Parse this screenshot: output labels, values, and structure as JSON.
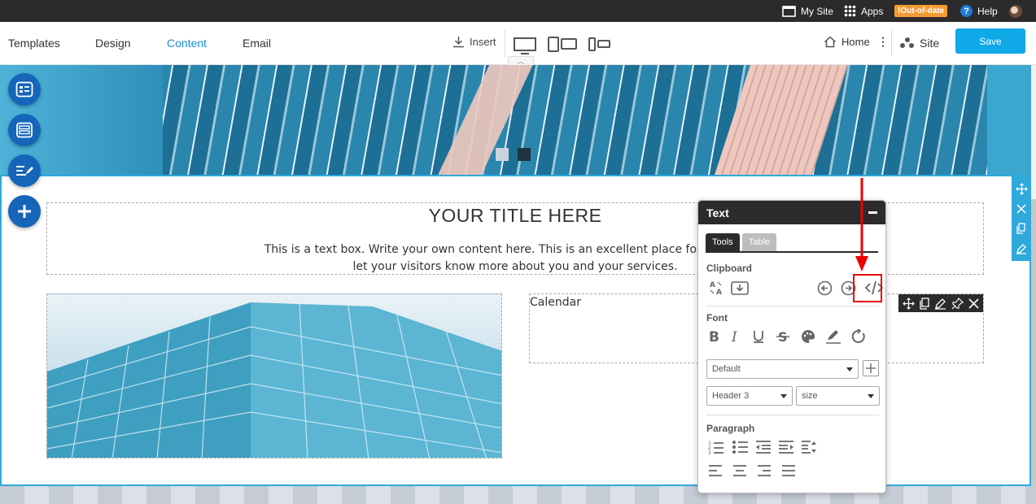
{
  "topbar": {
    "my_site": "My Site",
    "apps": "Apps",
    "badge": "!Out-of-date",
    "help": "Help"
  },
  "nav": {
    "tabs": [
      {
        "label": "Templates"
      },
      {
        "label": "Design"
      },
      {
        "label": "Content",
        "active": true
      },
      {
        "label": "Email"
      }
    ],
    "insert": "Insert",
    "home": "Home",
    "site": "Site",
    "save": "Save"
  },
  "content": {
    "title": "YOUR TITLE HERE",
    "text_line1": "This is a text box. Write your own content here. This is an excellent place for you to add",
    "text_line2": "let your visitors know more about you and your services.",
    "calendar": "Calendar"
  },
  "panel": {
    "title": "Text",
    "tabs": [
      "Tools",
      "Table"
    ],
    "clipboard": "Clipboard",
    "font": "Font",
    "font_family": "Default",
    "heading": "Header 3",
    "size": "size",
    "paragraph": "Paragraph"
  },
  "colors": {
    "accent": "#1a8fd6",
    "save": "#10a9e8",
    "dark": "#2b2b2b",
    "badge": "#f39c33",
    "highlight": "#e00000"
  }
}
